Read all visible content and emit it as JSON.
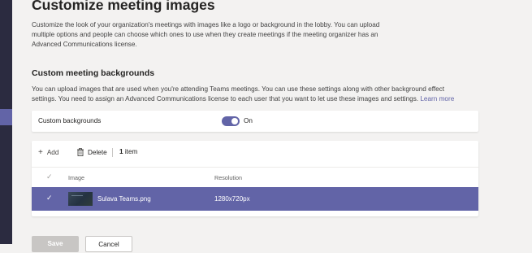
{
  "page": {
    "title": "Customize meeting images",
    "intro": "Customize the look of your organization's meetings with images like a logo or background in the lobby. You can upload multiple options and people can choose which ones to use when they create meetings if the meeting organizer has an Advanced Communications license."
  },
  "backgrounds_section": {
    "title": "Custom meeting backgrounds",
    "description": "You can upload images that are used when you're attending Teams meetings. You can use these settings along with other background effect settings. You need to assign an Advanced Communications license to each user that you want to let use these images and settings.",
    "learn_more": "Learn more"
  },
  "toggle": {
    "label": "Custom backgrounds",
    "state": "On"
  },
  "toolbar": {
    "add_label": "Add",
    "delete_label": "Delete",
    "count_value": "1",
    "count_unit": "item"
  },
  "table": {
    "columns": [
      "Image",
      "Resolution"
    ],
    "rows": [
      {
        "name": "Sulava Teams.png",
        "resolution": "1280x720px",
        "selected": true
      }
    ]
  },
  "actions": {
    "save_label": "Save",
    "cancel_label": "Cancel"
  },
  "colors": {
    "accent": "#6264a7",
    "nav": "#2b2b40",
    "background": "#f3f2f1"
  },
  "icons": [
    "plus-icon",
    "trash-icon",
    "checkmark-icon"
  ]
}
